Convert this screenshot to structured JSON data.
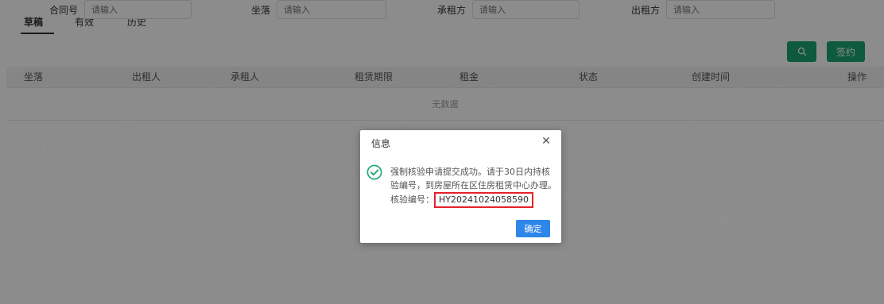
{
  "tabs": [
    {
      "label": "草稿"
    },
    {
      "label": "有效"
    },
    {
      "label": "历史"
    }
  ],
  "filters": {
    "contract_no": {
      "label": "合同号",
      "placeholder": "请输入"
    },
    "location": {
      "label": "坐落",
      "placeholder": "请输入"
    },
    "lessee": {
      "label": "承租方",
      "placeholder": "请输入"
    },
    "lessor": {
      "label": "出租方",
      "placeholder": "请输入"
    }
  },
  "buttons": {
    "search_icon": "search-icon",
    "sign_label": "签约"
  },
  "table": {
    "columns": [
      "坐落",
      "出租人",
      "承租人",
      "租赁期限",
      "租金",
      "状态",
      "创建时间",
      "操作"
    ],
    "empty_text": "无数据"
  },
  "watermark": {
    "name": "高云飞",
    "time": "2024/10/24 02:12:58"
  },
  "dialog": {
    "title": "信息",
    "close_icon": "close-icon",
    "success_icon": "check-circle-icon",
    "message": "强制核验申请提交成功。请于30日内持核验编号，到房屋所在区住房租赁中心办理。核验编号：",
    "code": "HY20241024058590",
    "ok_label": "确定"
  },
  "colors": {
    "accent_green": "#19a56d",
    "dialog_button_blue": "#2f86e9",
    "highlight_red": "#e3222b",
    "success_green": "#19a56d"
  }
}
